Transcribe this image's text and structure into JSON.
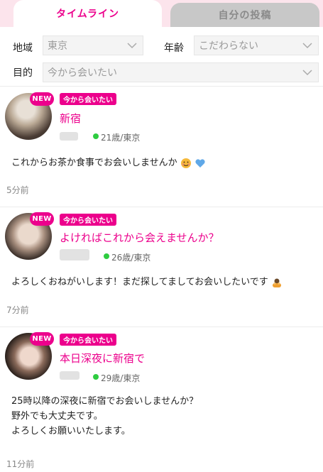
{
  "tabs": {
    "timeline": "タイムライン",
    "my_posts": "自分の投稿"
  },
  "filters": {
    "region_label": "地域",
    "region_value": "東京",
    "age_label": "年齢",
    "age_value": "こだわらない",
    "purpose_label": "目的",
    "purpose_value": "今から会いたい"
  },
  "posts": [
    {
      "badge": "NEW",
      "purpose": "今から会いたい",
      "title": "新宿",
      "meta": "21歳/東京",
      "body": "これからお茶か食事でお会いしませんか",
      "emoji": [
        "smiling-face-emoji",
        "blue-heart-emoji"
      ],
      "time": "5分前"
    },
    {
      "badge": "NEW",
      "purpose": "今から会いたい",
      "title": "よければこれから会えませんか？",
      "meta": "26歳/東京",
      "body": "よろしくおねがいします！まだ探してましてお会いしたいです",
      "emoji": [
        "bowing-person-emoji"
      ],
      "time": "7分前"
    },
    {
      "badge": "NEW",
      "purpose": "今から会いたい",
      "title": "本日深夜に新宿で",
      "meta": "29歳/東京",
      "body_lines": [
        "25時以降の深夜に新宿でお会いしませんか？",
        "野外でも大丈夫です。",
        "よろしくお願いいたします。"
      ],
      "time": "11分前"
    }
  ],
  "colors": {
    "accent": "#ec008c",
    "tab_bar_bg": "#fce4ec",
    "inactive_tab": "#c8c8c8",
    "online": "#2ecc40"
  }
}
